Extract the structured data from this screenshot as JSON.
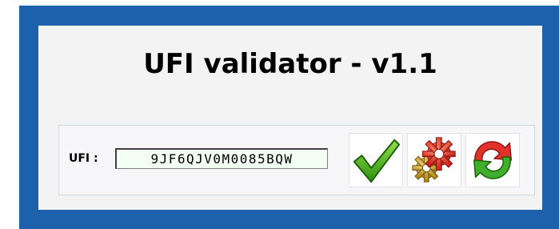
{
  "app": {
    "title": "UFI validator - v1.1"
  },
  "form": {
    "ufi_label": "UFI :",
    "ufi_value": "9JF6QJV0M0085BQW"
  },
  "buttons": [
    {
      "name": "validate",
      "icon": "check-icon"
    },
    {
      "name": "generate",
      "icon": "gears-icon"
    },
    {
      "name": "reset",
      "icon": "refresh-icon"
    }
  ],
  "colors": {
    "frame": "#1b61ab",
    "panel": "#f3f3f3",
    "input_background": "#f4fff4",
    "check_green": "#4fb81a",
    "gear_red": "#e0312a",
    "gear_gold": "#c89b2c",
    "arrow_red": "#e0312a",
    "arrow_green": "#3fae2a"
  }
}
